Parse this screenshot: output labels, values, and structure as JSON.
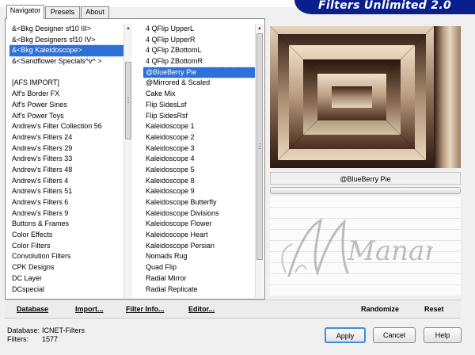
{
  "window": {
    "title": "Filters Unlimited 2.0"
  },
  "tabs": [
    {
      "label": "Navigator",
      "active": true
    },
    {
      "label": "Presets",
      "active": false
    },
    {
      "label": "About",
      "active": false
    }
  ],
  "categories": {
    "items": [
      "&<Bkg Designer sf10 III>",
      "&<Bkg Designers sf10 IV>",
      "&<Bkg Kaleidoscope>",
      "&<Sandflower Specials^v^ >",
      "",
      "[AFS IMPORT]",
      "Alf's Border FX",
      "Alf's Power Sines",
      "Alf's Power Toys",
      "Andrew's Filter Collection 56",
      "Andrew's Filters 24",
      "Andrew's Filters 29",
      "Andrew's Filters 33",
      "Andrew's Filters 48",
      "Andrew's Filters 4",
      "Andrew's Filters 51",
      "Andrew's Filters 6",
      "Andrew's Filters 9",
      "Buttons & Frames",
      "Color Effects",
      "Color Filters",
      "Convolution Filters",
      "CPK Designs",
      "DC Layer",
      "DCspecial"
    ],
    "selected_index": 2
  },
  "filters": {
    "items": [
      "4 QFlip UpperL",
      "4 QFlip UpperR",
      "4 QFlip ZBottomL",
      "4 QFlip ZBottomR",
      "@BlueBerry Pie",
      "@Mirrored & Scaled",
      "Cake Mix",
      "Flip SidesLsf",
      "Flip SidesRsf",
      "Kaleidoscope 1",
      "Kaleidoscope 2",
      "Kaleidoscope 3",
      "Kaleidoscope 4",
      "Kaleidoscope 5",
      "Kaleidoscope 8",
      "Kaleidoscope 9",
      "Kaleidoscope Butterfly",
      "Kaleidoscope Divisions",
      "Kaleidoscope Flower",
      "Kaleidoscope Heart",
      "Kaleidoscope Persian",
      "Nomads Rug",
      "Quad Flip",
      "Radial Mirror",
      "Radial Replicate"
    ],
    "selected_index": 4
  },
  "preview": {
    "filter_name": "@BlueBerry Pie"
  },
  "watermark": {
    "text": "Manany"
  },
  "toolbar": {
    "database": "Database",
    "import": "Import...",
    "filter_info": "Filter Info...",
    "editor": "Editor...",
    "randomize": "Randomize",
    "reset": "Reset"
  },
  "status": {
    "database_label": "Database:",
    "database_value": "ICNET-Filters",
    "filters_label": "Filters:",
    "filters_value": "1577"
  },
  "buttons": {
    "apply": "Apply",
    "cancel": "Cancel",
    "help": "Help"
  },
  "colors": {
    "banner": "#0a1e8c",
    "selection": "#2f6fd8",
    "preview_dark": "#3a2418",
    "preview_light": "#e2cfb6"
  }
}
